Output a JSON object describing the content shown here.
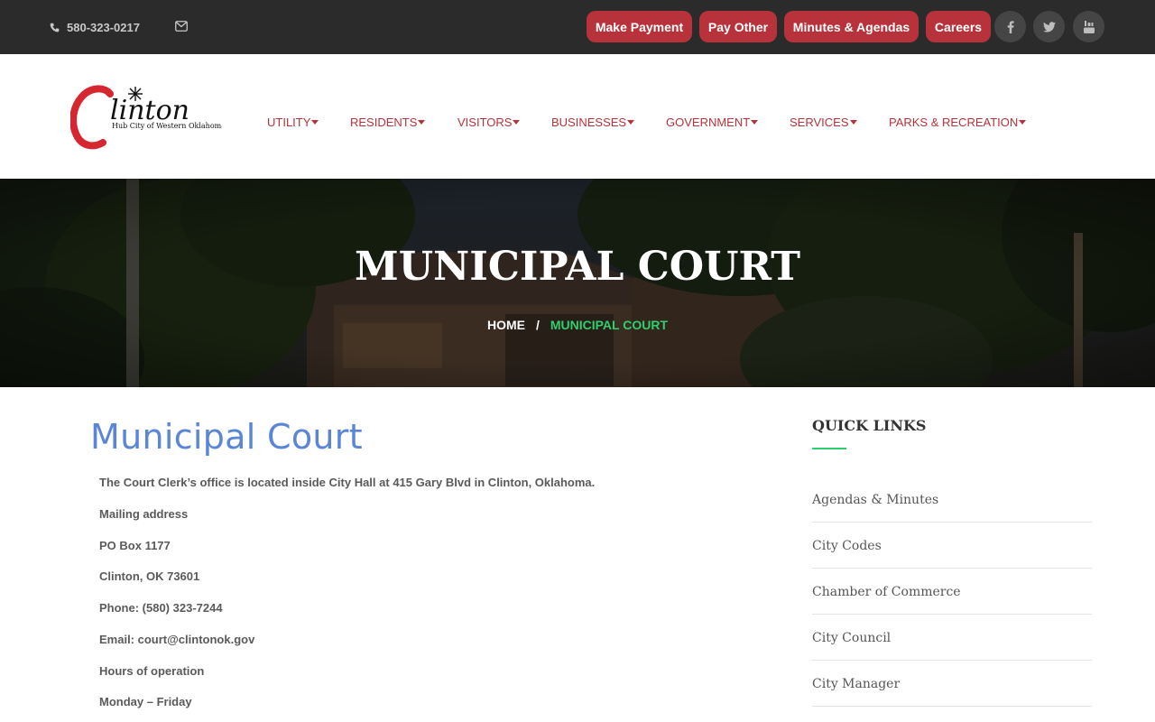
{
  "topbar": {
    "phone": "580-323-0217",
    "buttons": [
      "Make Payment",
      "Pay Other",
      "Minutes & Agendas",
      "Careers"
    ],
    "social": [
      "facebook-icon",
      "twitter-icon",
      "youtube-icon"
    ]
  },
  "logo": {
    "name": "Clinton",
    "tagline": "Hub City of Western Oklahoma"
  },
  "nav": [
    "UTILITY",
    "RESIDENTS",
    "VISITORS",
    "BUSINESSES",
    "GOVERNMENT",
    "SERVICES",
    "PARKS & RECREATION"
  ],
  "hero": {
    "title": "MUNICIPAL COURT",
    "breadcrumb_home": "HOME",
    "breadcrumb_sep": "/",
    "breadcrumb_current": "MUNICIPAL COURT"
  },
  "content": {
    "title": "Municipal Court",
    "paragraphs": [
      "The Court Clerk’s office is located inside City Hall at 415 Gary Blvd in Clinton, Oklahoma.",
      "Mailing address",
      "PO Box 1177",
      "Clinton, OK 73601",
      "Phone: (580) 323-7244",
      "Email: court@clintonok.gov",
      "Hours of operation",
      "Monday – Friday"
    ]
  },
  "sidebar": {
    "title": "QUICK LINKS",
    "links": [
      "Agendas & Minutes",
      "City Codes",
      "Chamber of Commerce",
      "City Council",
      "City Manager"
    ]
  },
  "colors": {
    "brand_red": "#b7323a",
    "accent_green": "#2ed06e",
    "title_blue": "#5b86d6",
    "topbar_bg": "#2b2b2b"
  }
}
